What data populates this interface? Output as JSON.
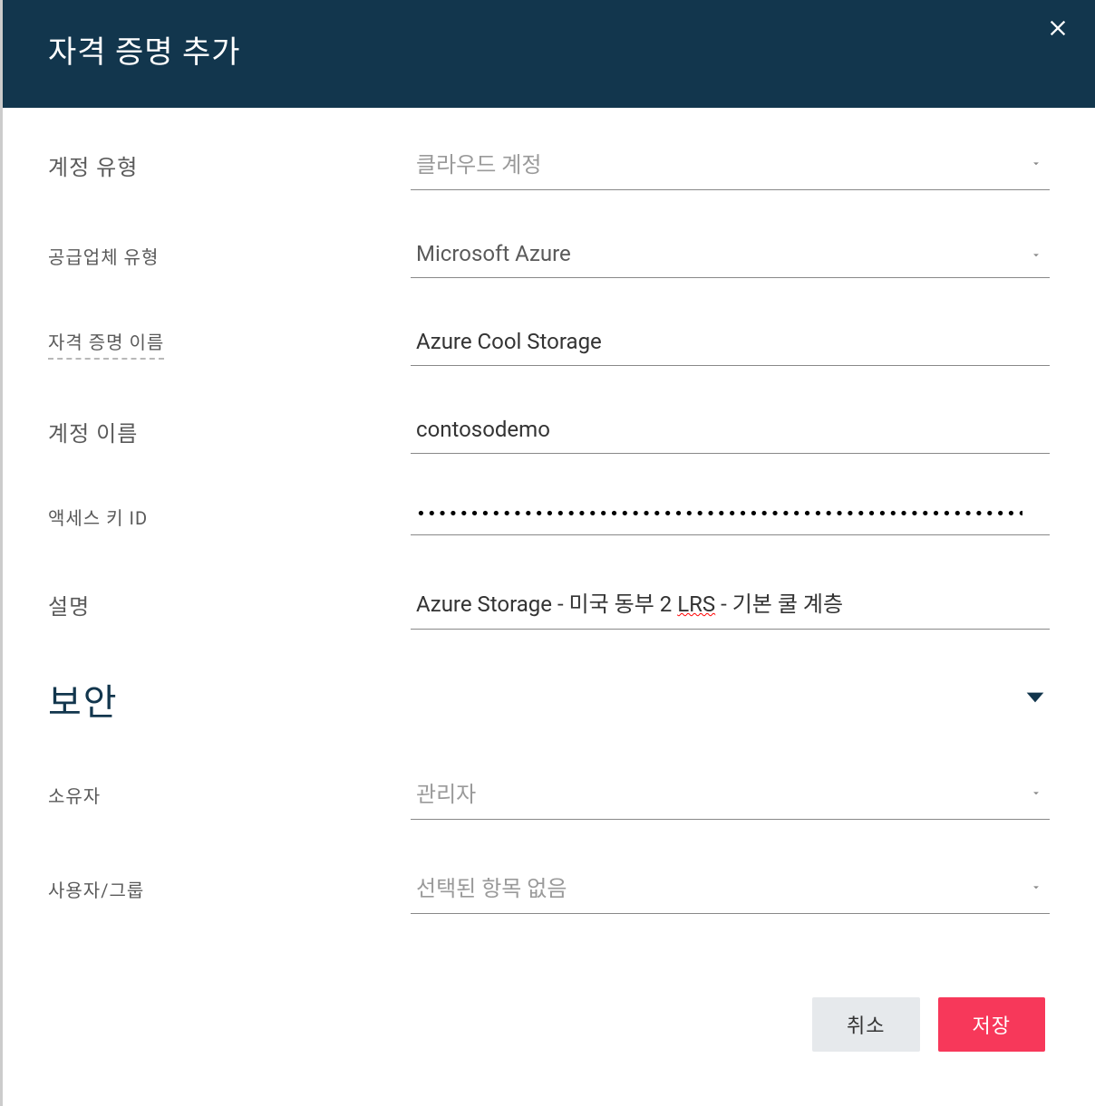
{
  "header": {
    "title": "자격 증명 추가"
  },
  "form": {
    "account_type": {
      "label": "계정 유형",
      "value": "클라우드 계정"
    },
    "vendor_type": {
      "label": "공급업체 유형",
      "value": "Microsoft Azure"
    },
    "credential_name": {
      "label": "자격 증명 이름",
      "value": "Azure Cool Storage"
    },
    "account_name": {
      "label": "계정 이름",
      "value": "contosodemo"
    },
    "access_key": {
      "label": "액세스 키 ID",
      "value": "••••••••••••••••••••••••••••••••••••••••••••••••••••••••••••••••••••••••"
    },
    "description": {
      "label": "설명",
      "prefix": "Azure Storage - 미국 동부 2 ",
      "spell": "LRS",
      "suffix": " - 기본 쿨 계층"
    },
    "security_section": "보안",
    "owner": {
      "label": "소유자",
      "value": "관리자"
    },
    "user_group": {
      "label": "사용자/그룹",
      "placeholder": "선택된 항목 없음"
    }
  },
  "footer": {
    "cancel": "취소",
    "save": "저장"
  }
}
